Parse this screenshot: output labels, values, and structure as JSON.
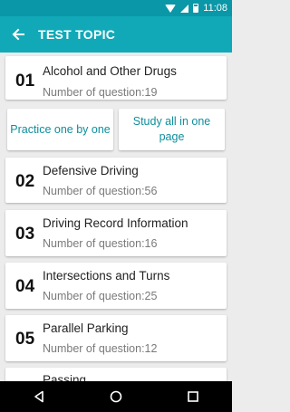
{
  "status_bar": {
    "time": "11:08"
  },
  "app_bar": {
    "title": "TEST TOPIC"
  },
  "buttons": {
    "practice": "Practice one by one",
    "study": "Study all in one page"
  },
  "topics": [
    {
      "number": "01",
      "title": "Alcohol and Other Drugs",
      "subtitle": "Number of question:19"
    },
    {
      "number": "02",
      "title": "Defensive Driving",
      "subtitle": "Number of question:56"
    },
    {
      "number": "03",
      "title": "Driving Record Information",
      "subtitle": "Number of question:16"
    },
    {
      "number": "04",
      "title": "Intersections and Turns",
      "subtitle": "Number of question:25"
    },
    {
      "number": "05",
      "title": "Parallel Parking",
      "subtitle": "Number of question:12"
    },
    {
      "title": "Passing"
    }
  ],
  "colors": {
    "app_bar": "#11a9b8",
    "status_bar": "#0a97a7",
    "accent_text": "#0e8e9c"
  },
  "icons": {
    "back": "arrow-left-icon",
    "wifi": "wifi-icon",
    "signal": "signal-icon",
    "battery": "battery-icon",
    "nav_back": "triangle-back-icon",
    "nav_home": "circle-home-icon",
    "nav_recent": "square-recent-icon"
  }
}
